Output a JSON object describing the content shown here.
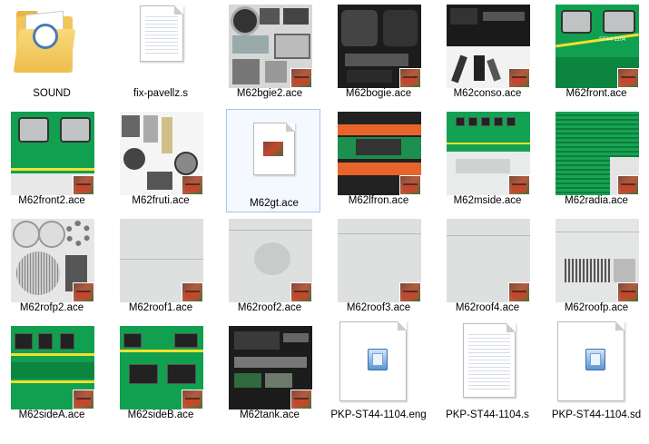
{
  "items": [
    {
      "label": "SOUND",
      "kind": "folder"
    },
    {
      "label": "fix-pavellz.s",
      "kind": "document"
    },
    {
      "label": "M62bgie2.ace",
      "kind": "texture"
    },
    {
      "label": "M62bogie.ace",
      "kind": "texture"
    },
    {
      "label": "M62conso.ace",
      "kind": "texture"
    },
    {
      "label": "M62front.ace",
      "kind": "texture"
    },
    {
      "label": "M62front2.ace",
      "kind": "texture"
    },
    {
      "label": "M62fruti.ace",
      "kind": "texture"
    },
    {
      "label": "M62gt.ace",
      "kind": "texture-generic"
    },
    {
      "label": "M62lfron.ace",
      "kind": "texture"
    },
    {
      "label": "M62mside.ace",
      "kind": "texture"
    },
    {
      "label": "M62radia.ace",
      "kind": "texture"
    },
    {
      "label": "M62rofp2.ace",
      "kind": "texture"
    },
    {
      "label": "M62roof1.ace",
      "kind": "texture"
    },
    {
      "label": "M62roof2.ace",
      "kind": "texture"
    },
    {
      "label": "M62roof3.ace",
      "kind": "texture"
    },
    {
      "label": "M62roof4.ace",
      "kind": "texture"
    },
    {
      "label": "M62roofp.ace",
      "kind": "texture"
    },
    {
      "label": "M62sideA.ace",
      "kind": "texture"
    },
    {
      "label": "M62sideB.ace",
      "kind": "texture"
    },
    {
      "label": "M62tank.ace",
      "kind": "texture"
    },
    {
      "label": "PKP-ST44-1104.eng",
      "kind": "app"
    },
    {
      "label": "PKP-ST44-1104.s",
      "kind": "document"
    },
    {
      "label": "PKP-ST44-1104.sd",
      "kind": "app"
    }
  ],
  "selected_index": 8,
  "colors": {
    "selection_border": "#9dc6f0",
    "selection_fill": "#f4f9ff",
    "loco_green": "#11a04f",
    "stripe_yellow": "#f2e12c"
  },
  "icons": {
    "folder": "folder-icon",
    "document": "document-icon",
    "app": "ace-file-icon",
    "badge": "locomotive-badge-icon"
  },
  "front_plate_text": "ST44-1104"
}
